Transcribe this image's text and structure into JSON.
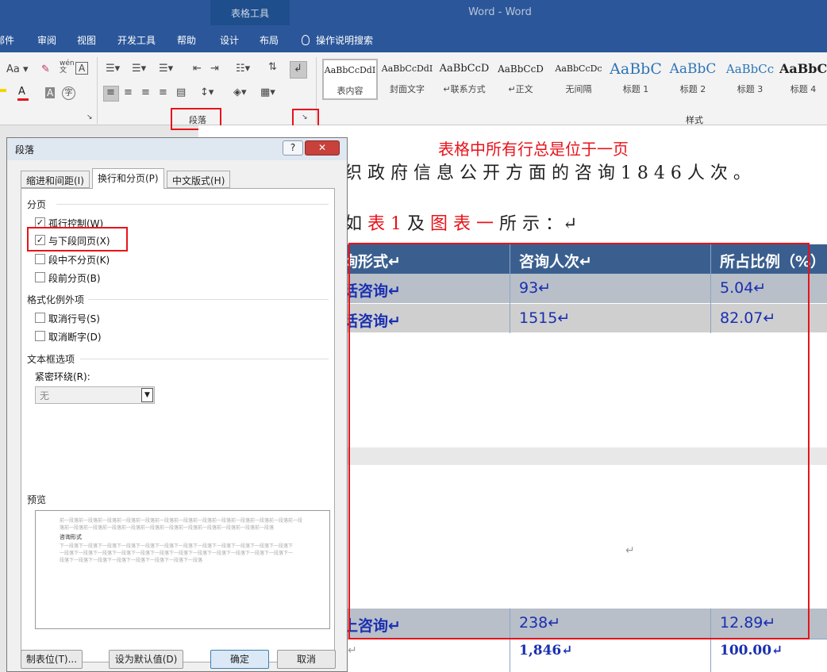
{
  "window": {
    "app_title": "Word  -  Word",
    "context_group": "表格工具"
  },
  "tabs": [
    "邮件",
    "审阅",
    "视图",
    "开发工具",
    "帮助",
    "设计",
    "布局"
  ],
  "tell_me": "操作说明搜索",
  "ribbon": {
    "font_aa": "Aa",
    "font_wen": "wén\n文",
    "font_a_box": "A",
    "font_a_color": "A",
    "font_a_shade": "A",
    "font_zi": "字",
    "paragraph_group": "段落",
    "styles_group": "样式",
    "styles": [
      {
        "sample": "AaBbCcDdI",
        "name": "表内容"
      },
      {
        "sample": "AaBbCcDdI",
        "name": "封面文字"
      },
      {
        "sample": "AaBbCcD",
        "name": "↵联系方式"
      },
      {
        "sample": "AaBbCcD",
        "name": "↵正文"
      },
      {
        "sample": "AaBbCcDc",
        "name": "无间隔"
      },
      {
        "sample": "AaBbC",
        "name": "标题 1"
      },
      {
        "sample": "AaBbC",
        "name": "标题 2"
      },
      {
        "sample": "AaBbCc",
        "name": "标题 3"
      },
      {
        "sample": "AaBbC",
        "name": "标题 4"
      }
    ]
  },
  "annotation": "表格中所有行总是位于一页",
  "document": {
    "line1": "织 政 府 信 息 公 开 方 面 的 咨 询 1 8 4 6 人 次 。",
    "line2a": "如 ",
    "line2b": "表 1",
    "line2c": " 及 ",
    "line2d": "图 表 一",
    "line2e": " 所 示 ：↵",
    "table": {
      "headers": [
        "询形式↵",
        "咨询人次↵",
        "所占比例（%）"
      ],
      "rows": [
        [
          "话咨询↵",
          "93↵",
          "5.04↵"
        ],
        [
          "话咨询↵",
          "1515↵",
          "82.07↵"
        ]
      ],
      "row_last": [
        "上咨询↵",
        "238↵",
        "12.89↵"
      ],
      "total": [
        "↵",
        "1,846↵",
        "100.00↵"
      ],
      "empty_mark": "↵"
    }
  },
  "dialog": {
    "title": "段落",
    "help": "?",
    "close": "✕",
    "tabs": [
      "缩进和间距(I)",
      "换行和分页(P)",
      "中文版式(H)"
    ],
    "pagination_title": "分页",
    "pagination": [
      {
        "label": "孤行控制(W)",
        "checked": "✓"
      },
      {
        "label": "与下段同页(X)",
        "checked": "✓"
      },
      {
        "label": "段中不分页(K)",
        "checked": ""
      },
      {
        "label": "段前分页(B)",
        "checked": ""
      }
    ],
    "exceptions_title": "格式化例外项",
    "exceptions": [
      {
        "label": "取消行号(S)",
        "checked": ""
      },
      {
        "label": "取消断字(D)",
        "checked": ""
      }
    ],
    "textbox_title": "文本框选项",
    "wrap_label": "紧密环绕(R):",
    "wrap_value": "无",
    "preview_title": "预览",
    "preview_prev": "前一段落前一段落前一段落前一段落前一段落前一段落前一段落前一段落前一段落前一段落前一段落前一段落前一段落前一段落前一段落前一段落前一段落前一段落前一段落前一段落前一段落前一段落前一段落前一段落",
    "preview_current": "咨询形式",
    "preview_next": "下一段落下一段落下一段落下一段落下一段落下一段落下一段落下一段落下一段落下一段落下一段落下一段落下一段落下一段落下一段落下一段落下一段落下一段落下一段落下一段落下一段落下一段落下一段落下一段落下一段落下一段落下一段落下一段落下一段落下一段落下一段落下一段落",
    "buttons": {
      "tabs": "制表位(T)...",
      "default": "设为默认值(D)",
      "ok": "确定",
      "cancel": "取消"
    }
  },
  "colors": {
    "accent": "#2b579a",
    "annotation_red": "#e8131a",
    "table_header": "#3a5f8f",
    "table_blue_text": "#1a2fb0"
  }
}
